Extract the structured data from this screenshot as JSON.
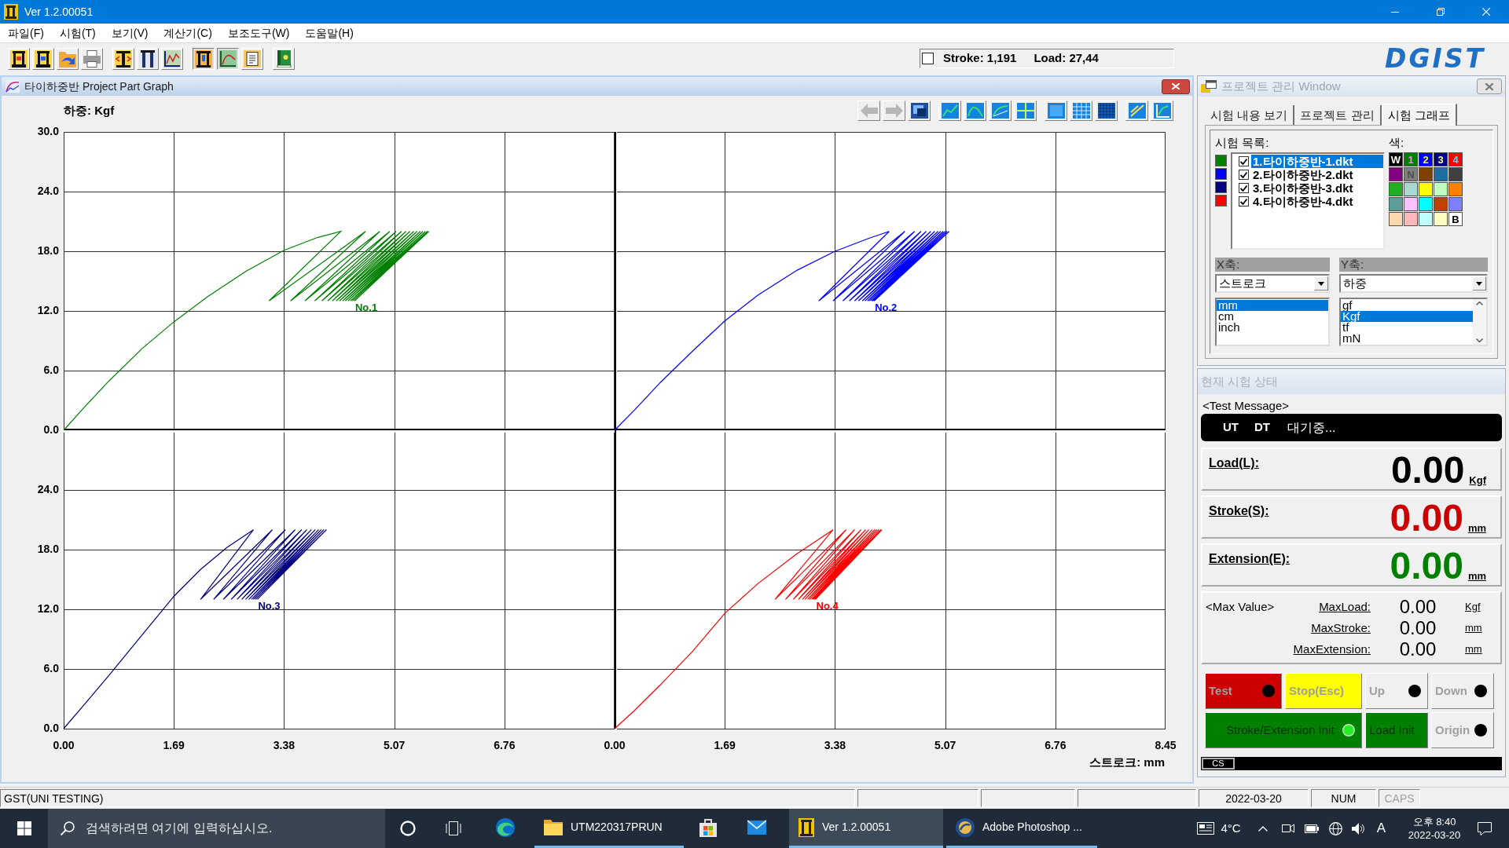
{
  "window": {
    "title": "Ver 1.2.00051"
  },
  "menu": [
    "파일(F)",
    "시험(T)",
    "보기(V)",
    "계산기(C)",
    "보조도구(W)",
    "도움말(H)"
  ],
  "toolbar": [
    [
      {
        "pressed": false
      },
      {
        "pressed": false
      },
      {
        "pressed": false
      },
      {
        "pressed": false
      }
    ],
    [
      {
        "pressed": false
      },
      {
        "pressed": false
      },
      {
        "pressed": false
      }
    ],
    [
      {
        "pressed": true
      },
      {
        "pressed": true
      },
      {
        "pressed": false
      }
    ],
    [
      {
        "pressed": false
      }
    ]
  ],
  "readout": {
    "checked": false,
    "stroke": "Stroke: 1,191",
    "load": "Load: 27,44"
  },
  "logo": "DGIST",
  "graph_window": {
    "title": "타이하중반 Project Part Graph",
    "y_title": "하중: Kgf",
    "x_title": "스트로크: mm",
    "tools": [
      [
        {
          "disabled": true
        },
        {
          "disabled": true
        },
        {
          "disabled": false
        }
      ],
      [
        {
          "disabled": false
        },
        {
          "disabled": false
        },
        {
          "disabled": false
        },
        {
          "disabled": false
        }
      ],
      [
        {
          "disabled": false
        },
        {
          "disabled": false
        },
        {
          "disabled": false
        }
      ],
      [
        {
          "disabled": false
        },
        {
          "disabled": false
        }
      ]
    ],
    "charts": [
      {
        "chart_data": {
          "type": "line",
          "grid": true,
          "xlim": [
            0,
            8.45
          ],
          "ylim": [
            0,
            30
          ],
          "yticks": [
            {
              "value": 0,
              "label": "0.0"
            },
            {
              "value": 6,
              "label": "6.0"
            },
            {
              "value": 12,
              "label": "12.0"
            },
            {
              "value": 18,
              "label": "18.0"
            },
            {
              "value": 24,
              "label": "24.0"
            },
            {
              "value": 30,
              "label": "30.0"
            }
          ],
          "x": [
            0,
            0.3,
            0.7,
            1.2,
            1.69,
            2.2,
            2.8,
            3.38,
            3.9,
            4.25,
            3.15,
            4.63,
            3.48,
            4.85,
            3.7,
            5.0,
            3.85,
            5.1,
            3.96,
            5.18,
            4.05,
            5.25,
            4.12,
            5.31,
            4.18,
            5.37,
            4.23,
            5.42,
            4.28,
            5.47,
            4.32,
            5.51,
            4.36,
            5.55,
            4.4,
            5.58,
            4.43,
            5.6,
            4.46
          ],
          "series": [
            {
              "color": "#008000",
              "values": [
                0,
                2.2,
                5,
                8.2,
                10.9,
                13.4,
                16,
                18.1,
                19.4,
                20,
                13,
                20,
                13,
                20,
                13,
                20,
                13,
                20,
                13,
                20,
                13,
                20,
                13,
                20,
                13,
                20,
                13,
                20,
                13,
                20,
                13,
                20,
                13,
                20,
                13,
                20,
                13,
                20,
                13
              ]
            }
          ],
          "annotations": [
            "No.1"
          ]
        }
      },
      {
        "chart_data": {
          "type": "line",
          "grid": true,
          "xlim": [
            0,
            8.45
          ],
          "ylim": [
            0,
            30
          ],
          "x": [
            0,
            0.3,
            0.7,
            1.2,
            1.69,
            2.2,
            2.8,
            3.38,
            3.9,
            4.21,
            3.13,
            4.45,
            3.35,
            4.6,
            3.5,
            4.7,
            3.6,
            4.78,
            3.68,
            4.85,
            3.74,
            4.91,
            3.8,
            4.96,
            3.84,
            5.0,
            3.88,
            5.04,
            3.91,
            5.07,
            3.94,
            5.1,
            3.96,
            5.13,
            3.98
          ],
          "series": [
            {
              "color": "#0000ff",
              "values": [
                0,
                2,
                4.8,
                8,
                11,
                13.6,
                16.1,
                18,
                19.3,
                20,
                13,
                20,
                13,
                20,
                13,
                20,
                13,
                20,
                13,
                20,
                13,
                20,
                13,
                20,
                13,
                20,
                13,
                20,
                13,
                20,
                13,
                20,
                13,
                20,
                13
              ]
            }
          ],
          "annotations": [
            "No.2"
          ]
        }
      },
      {
        "chart_data": {
          "type": "line",
          "grid": true,
          "xlim": [
            0,
            8.45
          ],
          "ylim": [
            0,
            30
          ],
          "xticks": [
            {
              "value": 0,
              "label": "0.00"
            },
            {
              "value": 1.69,
              "label": "1.69"
            },
            {
              "value": 3.38,
              "label": "3.38"
            },
            {
              "value": 5.07,
              "label": "5.07"
            },
            {
              "value": 6.76,
              "label": "6.76"
            }
          ],
          "yticks": [
            {
              "value": 0,
              "label": "0.0"
            },
            {
              "value": 6,
              "label": "6.0"
            },
            {
              "value": 12,
              "label": "12.0"
            },
            {
              "value": 18,
              "label": "18.0"
            },
            {
              "value": 24,
              "label": "24.0"
            }
          ],
          "x": [
            0,
            0.3,
            0.7,
            1.2,
            1.69,
            2.1,
            2.5,
            2.91,
            2.1,
            3.2,
            2.3,
            3.4,
            2.45,
            3.55,
            2.57,
            3.65,
            2.66,
            3.73,
            2.73,
            3.8,
            2.79,
            3.86,
            2.84,
            3.91,
            2.88,
            3.95,
            2.91,
            3.99,
            2.94,
            4.03,
            2.97
          ],
          "series": [
            {
              "color": "#000080",
              "values": [
                0,
                2.3,
                5.4,
                9.4,
                13.3,
                16,
                18.2,
                20,
                13,
                20,
                13,
                20,
                13,
                20,
                13,
                20,
                13,
                20,
                13,
                20,
                13,
                20,
                13,
                20,
                13,
                20,
                13,
                20,
                13,
                20,
                13
              ]
            }
          ],
          "annotations": [
            "No.3"
          ]
        }
      },
      {
        "chart_data": {
          "type": "line",
          "grid": true,
          "xlim": [
            0,
            8.45
          ],
          "ylim": [
            0,
            30
          ],
          "xticks": [
            {
              "value": 0,
              "label": "0.00"
            },
            {
              "value": 1.69,
              "label": "1.69"
            },
            {
              "value": 3.38,
              "label": "3.38"
            },
            {
              "value": 5.07,
              "label": "5.07"
            },
            {
              "value": 6.76,
              "label": "6.76"
            },
            {
              "value": 8.45,
              "label": "8.45"
            }
          ],
          "x": [
            0,
            0.3,
            0.7,
            1.2,
            1.69,
            2.2,
            2.8,
            3.35,
            2.46,
            3.55,
            2.62,
            3.68,
            2.74,
            3.78,
            2.82,
            3.85,
            2.88,
            3.9,
            2.92,
            3.95,
            2.96,
            3.99,
            2.99,
            4.02,
            3.02,
            4.05,
            3.04,
            4.08,
            3.06,
            4.1,
            3.08
          ],
          "series": [
            {
              "color": "#ff0000",
              "values": [
                0,
                1.8,
                4.4,
                7.8,
                11.6,
                14.6,
                17.6,
                20,
                13,
                20,
                13,
                20,
                13,
                20,
                13,
                20,
                13,
                20,
                13,
                20,
                13,
                20,
                13,
                20,
                13,
                20,
                13,
                20,
                13,
                20,
                13
              ]
            }
          ],
          "annotations": [
            "No.4"
          ]
        }
      }
    ]
  },
  "project_window": {
    "title": "프로젝트 관리 Window",
    "tabs": [
      {
        "label": "시험 내용 보기",
        "selected": false
      },
      {
        "label": "프로젝트 관리",
        "selected": false
      },
      {
        "label": "시험 그래프",
        "selected": true
      }
    ],
    "list_label": "시험 목록:",
    "tests": [
      {
        "label": "1.타이하중반-1.dkt",
        "color": "#008000",
        "checked": true,
        "selected": true
      },
      {
        "label": "2.타이하중반-2.dkt",
        "color": "#0000ff",
        "checked": true,
        "selected": false
      },
      {
        "label": "3.타이하중반-3.dkt",
        "color": "#000080",
        "checked": true,
        "selected": false
      },
      {
        "label": "4.타이하중반-4.dkt",
        "color": "#ff0000",
        "checked": true,
        "selected": false
      }
    ],
    "palette_label": "색:",
    "palette": [
      {
        "color": "#000000",
        "text": "W"
      },
      {
        "color": "#008000",
        "text": "1"
      },
      {
        "color": "#0000ff",
        "text": "2"
      },
      {
        "color": "#000080",
        "text": "3"
      },
      {
        "color": "#ff0000",
        "text": "4"
      },
      {
        "color": "#800080"
      },
      {
        "color": "#808080",
        "text": "N"
      },
      {
        "color": "#804000"
      },
      {
        "color": "#1c6fa0"
      },
      {
        "color": "#404040"
      },
      {
        "color": "#22b022"
      },
      {
        "color": "#a8d8d0"
      },
      {
        "color": "#ffff00"
      },
      {
        "color": "#c0ffc0"
      },
      {
        "color": "#ff8000"
      },
      {
        "color": "#5aa098"
      },
      {
        "color": "#ffc0ff"
      },
      {
        "color": "#00ffff"
      },
      {
        "color": "#c04000"
      },
      {
        "color": "#8080ff"
      },
      {
        "color": "#ffd8b0"
      },
      {
        "color": "#ffb8b8"
      },
      {
        "color": "#c0ffff"
      },
      {
        "color": "#ffffc0"
      },
      {
        "color": "#ffffff",
        "text": "B"
      }
    ],
    "x_axis": {
      "label": "X축:",
      "value": "스트로크",
      "units": [
        {
          "label": "mm",
          "selected": true
        },
        {
          "label": "cm",
          "selected": false
        },
        {
          "label": "inch",
          "selected": false
        }
      ]
    },
    "y_axis": {
      "label": "Y축:",
      "value": "하중",
      "units": [
        {
          "label": "gf",
          "selected": false
        },
        {
          "label": "Kgf",
          "selected": true
        },
        {
          "label": "tf",
          "selected": false
        },
        {
          "label": "mN",
          "selected": false
        }
      ]
    }
  },
  "status_panel": {
    "title": "현재 시험 상태",
    "message_label": "<Test Message>",
    "message_tags": [
      "UT",
      "DT"
    ],
    "message": "대기중...",
    "readouts": [
      {
        "label": "Load(L):",
        "value": "0.00",
        "unit": "Kgf",
        "color": "#000000"
      },
      {
        "label": "Stroke(S):",
        "value": "0.00",
        "unit": "mm",
        "color": "#cc0000"
      },
      {
        "label": "Extension(E):",
        "value": "0.00",
        "unit": "mm",
        "color": "#008000"
      }
    ],
    "max_label": "<Max Value>",
    "max_values": [
      {
        "label": "MaxLoad:",
        "value": "0.00",
        "unit": "Kgf"
      },
      {
        "label": "MaxStroke:",
        "value": "0.00",
        "unit": "mm"
      },
      {
        "label": "MaxExtension:",
        "value": "0.00",
        "unit": "mm"
      }
    ],
    "controls": [
      [
        {
          "label": "Test",
          "color": "#cc0000",
          "disabled": true,
          "lit": false
        },
        {
          "label": "Stop(Esc)",
          "color": "#ffff00",
          "disabled": true
        },
        {
          "label": "Up",
          "color": "#f0f0f0",
          "disabled": true,
          "lit": false
        },
        {
          "label": "Down",
          "color": "#f0f0f0",
          "disabled": true,
          "lit": false
        }
      ],
      [
        {
          "label": "Stroke/Extension Init",
          "color": "#008000",
          "disabled": false,
          "lit": true
        },
        {
          "label": "Load Init",
          "color": "#008000",
          "disabled": false
        },
        {
          "label": "Origin",
          "color": "#f0f0f0",
          "disabled": true,
          "lit": false
        }
      ]
    ],
    "cs_label": "CS"
  },
  "status_bar": {
    "text": "GST(UNI TESTING)",
    "date": "2022-03-20",
    "keys": [
      {
        "label": "NUM",
        "on": true
      },
      {
        "label": "CAPS",
        "on": false
      }
    ]
  },
  "taskbar": {
    "search_placeholder": "검색하려면 여기에 입력하십시오.",
    "apps": [
      {
        "running": false,
        "active": false
      },
      {
        "label": "UTM220317PRUN",
        "running": true,
        "active": false
      },
      {
        "running": false,
        "active": false
      },
      {
        "running": false,
        "active": false
      },
      {
        "label": "Ver 1.2.00051",
        "running": true,
        "active": true
      },
      {
        "label": "Adobe Photoshop ...",
        "running": true,
        "active": false
      }
    ],
    "weather": "4°C",
    "ime": "A",
    "time": "오후 8:40",
    "date": "2022-03-20"
  }
}
